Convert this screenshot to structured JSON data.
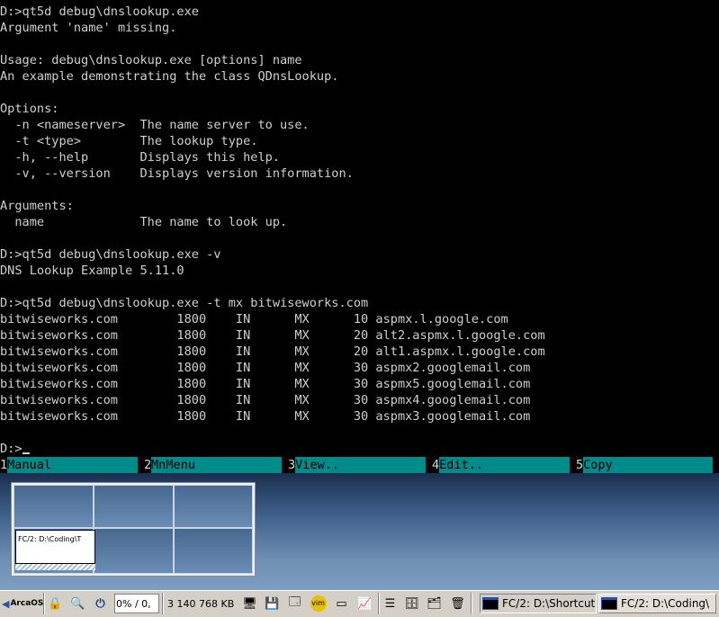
{
  "terminal": {
    "lines": [
      "D:>qt5d debug\\dnslookup.exe",
      "Argument 'name' missing.",
      "",
      "Usage: debug\\dnslookup.exe [options] name",
      "An example demonstrating the class QDnsLookup.",
      "",
      "Options:",
      "  -n <nameserver>  The name server to use.",
      "  -t <type>        The lookup type.",
      "  -h, --help       Displays this help.",
      "  -v, --version    Displays version information.",
      "",
      "Arguments:",
      "  name             The name to look up.",
      "",
      "D:>qt5d debug\\dnslookup.exe -v",
      "DNS Lookup Example 5.11.0",
      "",
      "D:>qt5d debug\\dnslookup.exe -t mx bitwiseworks.com",
      "bitwiseworks.com        1800    IN      MX      10 aspmx.l.google.com",
      "bitwiseworks.com        1800    IN      MX      20 alt2.aspmx.l.google.com",
      "bitwiseworks.com        1800    IN      MX      20 alt1.aspmx.l.google.com",
      "bitwiseworks.com        1800    IN      MX      30 aspmx2.googlemail.com",
      "bitwiseworks.com        1800    IN      MX      30 aspmx5.googlemail.com",
      "bitwiseworks.com        1800    IN      MX      30 aspmx4.googlemail.com",
      "bitwiseworks.com        1800    IN      MX      30 aspmx3.googlemail.com",
      ""
    ],
    "prompt": "D:>"
  },
  "function_keys": [
    {
      "num": "1",
      "label": "Manual"
    },
    {
      "num": "2",
      "label": "MnMenu"
    },
    {
      "num": "3",
      "label": "View.."
    },
    {
      "num": "4",
      "label": "Edit.."
    },
    {
      "num": "5",
      "label": "Copy"
    }
  ],
  "pager": {
    "window_title": "FC/2: D:\\Coding\\T"
  },
  "taskbar": {
    "start_label": "ArcaOS",
    "cpu_label": "0% / 0,",
    "memory_label": "3 140 768 KB",
    "tasks": [
      {
        "label": "FC/2: D:\\Shortcut"
      },
      {
        "label": "FC/2: D:\\Coding\\"
      }
    ]
  },
  "colors": {
    "fkey_bg": "#008b8b",
    "terminal_fg": "#d0d0d0",
    "taskbar_bg": "#d4d0c8"
  }
}
